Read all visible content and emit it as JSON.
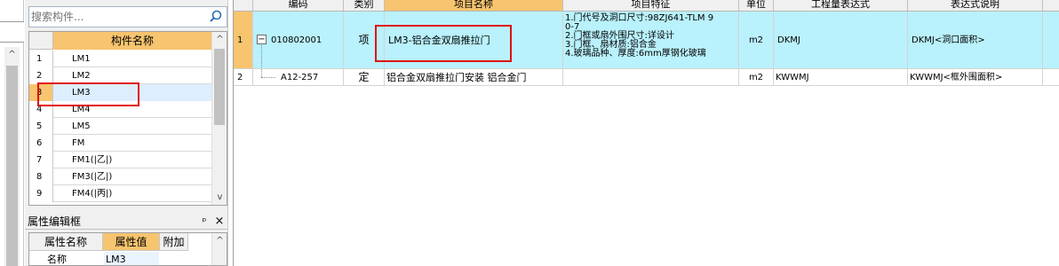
{
  "search": {
    "placeholder": "搜索构件..."
  },
  "components": {
    "header": "构件名称",
    "rows": [
      {
        "no": "1",
        "name": "LM1"
      },
      {
        "no": "2",
        "name": "LM2"
      },
      {
        "no": "3",
        "name": "LM3"
      },
      {
        "no": "4",
        "name": "LM4"
      },
      {
        "no": "5",
        "name": "LM5"
      },
      {
        "no": "6",
        "name": "FM"
      },
      {
        "no": "7",
        "name": "FM1(|乙|)"
      },
      {
        "no": "8",
        "name": "FM3(|乙|)"
      },
      {
        "no": "9",
        "name": "FM4(|丙|)"
      }
    ],
    "selected_index": 2
  },
  "property_panel": {
    "title": "属性编辑框",
    "pin_icon": "pin-icon",
    "close_icon": "close-icon",
    "headers": [
      "属性名称",
      "属性值",
      "附加"
    ],
    "rows": [
      {
        "name": "名称",
        "value": "LM3"
      }
    ]
  },
  "grid": {
    "headers": [
      "编码",
      "类别",
      "项目名称",
      "项目特征",
      "单位",
      "工程量表达式",
      "表达式说明"
    ],
    "rows": [
      {
        "no": "1",
        "tree_toggle": "−",
        "code": "010802001",
        "category": "项",
        "name": "LM3-铝合金双扇推拉门",
        "features": [
          "1.门代号及洞口尺寸:98ZJ641-TLM 9",
          "0-7",
          "2.门框或扇外围尺寸:详设计",
          "3.门框、扇材质:铝合金",
          "4.玻璃品种、厚度:6mm厚钢化玻璃"
        ],
        "unit": "m2",
        "expr": "DKMJ",
        "expr_desc": "DKMJ<洞口面积>"
      },
      {
        "no": "2",
        "code": "A12-257",
        "category": "定",
        "name": "铝合金双扇推拉门安装 铝合金门",
        "features": [],
        "unit": "m2",
        "expr": "KWWMJ",
        "expr_desc": "KWWMJ<框外围面积>"
      }
    ]
  },
  "colors": {
    "header_highlight": "#f7c46f",
    "selected_row": "#b9f1fc",
    "annotation_box": "#e01010"
  }
}
